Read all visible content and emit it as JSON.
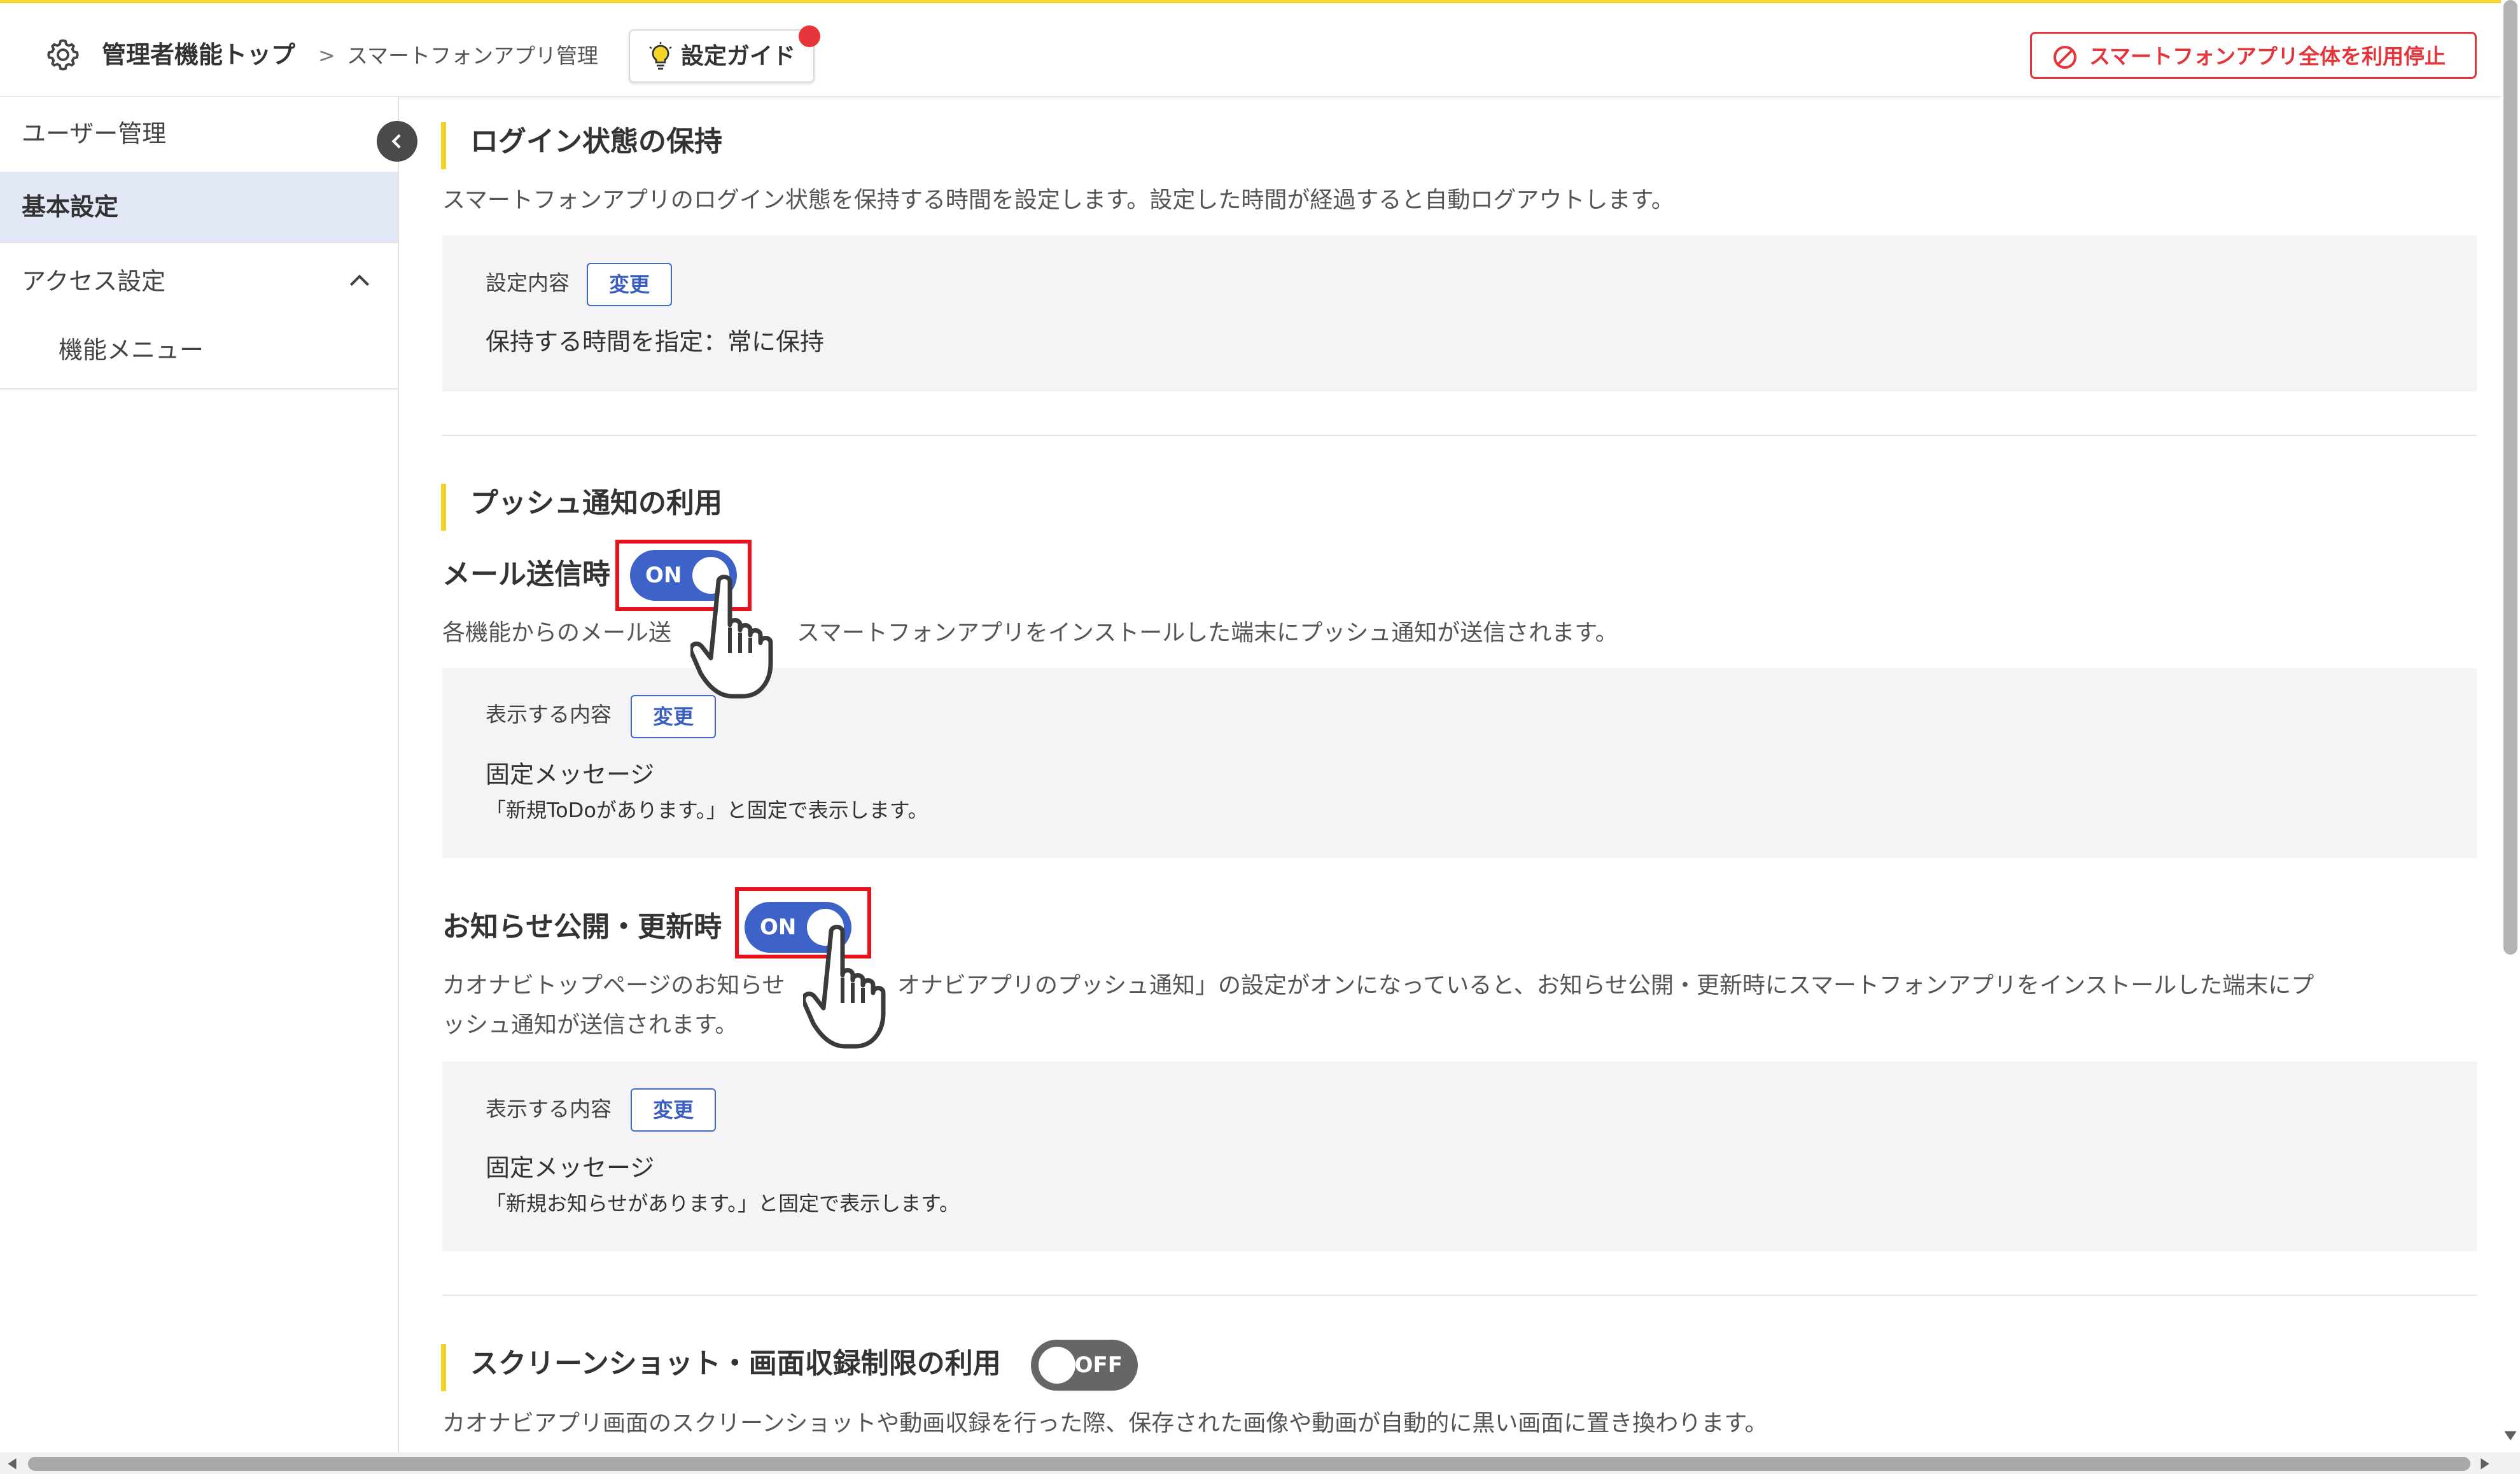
{
  "header": {
    "title": "管理者機能トップ",
    "breadcrumb_current": "スマートフォンアプリ管理",
    "guide_button": "設定ガイド",
    "stop_button": "スマートフォンアプリ全体を利用停止",
    "accent_color": "#f5d52c",
    "danger_color": "#e5343a"
  },
  "sidebar": {
    "items": [
      {
        "label": "ユーザー管理"
      },
      {
        "label": "基本設定"
      },
      {
        "label": "アクセス設定"
      },
      {
        "label": "機能メニュー"
      }
    ],
    "active_item": "基本設定"
  },
  "login_section": {
    "heading": "ログイン状態の保持",
    "description": "スマートフォンアプリのログイン状態を保持する時間を設定します。設定した時間が経過すると自動ログアウトします。",
    "box_label": "設定内容",
    "change_button": "変更",
    "value": "保持する時間を指定：常に保持"
  },
  "push_section": {
    "heading": "プッシュ通知の利用",
    "mail": {
      "label": "メール送信時",
      "toggle": "ON",
      "description_part1": "各機能からのメール送",
      "description_part2": "スマートフォンアプリをインストールした端末にプッシュ通知が送信されます。",
      "box_label": "表示する内容",
      "change_button": "変更",
      "value": "固定メッセージ",
      "sub": "「新規ToDoがあります。」と固定で表示します。"
    },
    "notice": {
      "label": "お知らせ公開・更新時",
      "toggle": "ON",
      "description_line1_part1": "カオナビトップページのお知らせ",
      "description_line1_part2": "オナビアプリのプッシュ通知」の設定がオンになっていると、お知らせ公開・更新時にスマートフォンアプリをインストールした端末にプ",
      "description_line2": "ッシュ通知が送信されます。",
      "box_label": "表示する内容",
      "change_button": "変更",
      "value": "固定メッセージ",
      "sub": "「新規お知らせがあります。」と固定で表示します。"
    }
  },
  "screenshot_section": {
    "heading": "スクリーンショット・画面収録制限の利用",
    "toggle": "OFF",
    "description": "カオナビアプリ画面のスクリーンショットや動画収録を行った際、保存された画像や動画が自動的に黒い画面に置き換わります。"
  },
  "icons": {
    "gear": "gear-icon",
    "bulb": "lightbulb-icon",
    "prohibit": "prohibit-icon",
    "collapse": "chevron-left-icon",
    "expand": "chevron-up-icon",
    "pointer": "hand-pointer-icon"
  },
  "highlight_color": "#e8121c",
  "toggle_on_color": "#3e63c8"
}
